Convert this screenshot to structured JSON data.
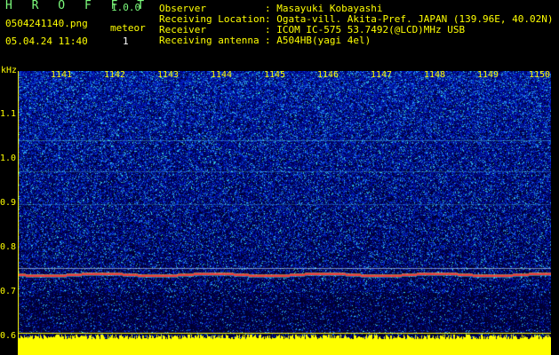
{
  "header": {
    "app_title": "H R O F F T",
    "app_version": "1.0.0",
    "file_name": "0504241140.png",
    "timestamp": "05.04.24 11:40",
    "meteor_label": "meteor",
    "meteor_count": "1"
  },
  "info": [
    {
      "key": "Observer",
      "value": ": Masayuki Kobayashi"
    },
    {
      "key": "Receiving Location",
      "value": ": Ogata-vill. Akita-Pref. JAPAN (139.96E, 40.02N)"
    },
    {
      "key": "Receiver",
      "value": ": ICOM IC-575 53.7492(@LCD)MHz USB"
    },
    {
      "key": "Receiving antenna",
      "value": ": A504HB(yagi 4el)"
    }
  ],
  "axis": {
    "y_unit": "kHz",
    "y_ticks": [
      "1.1",
      "1.0",
      "0.9",
      "0.8",
      "0.7",
      "0.6"
    ],
    "x_ticks": [
      "1141",
      "1142",
      "1143",
      "1144",
      "1145",
      "1146",
      "1147",
      "1148",
      "1149",
      "1150"
    ]
  },
  "colors": {
    "background_noise": "#0b1a8c",
    "signal_line": "#ff4040",
    "amplitude_bar": "#ffff00",
    "label": "#ffff00",
    "title": "#7CFC7C"
  }
}
